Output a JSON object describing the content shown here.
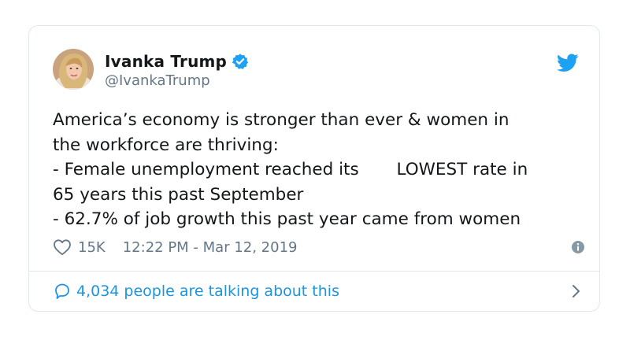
{
  "tweet": {
    "display_name": "Ivanka Trump",
    "handle": "@IvankaTrump",
    "text": "America’s economy is stronger than ever & women in\nthe workforce are thriving:\n- Female unemployment reached its       LOWEST rate in\n65 years this past September\n- 62.7% of job growth this past year came from women",
    "likes": "15K",
    "timestamp": "12:22 PM - Mar 12, 2019",
    "talking": "4,034 people are talking about this"
  },
  "icons": {
    "verified": "verified-badge-icon",
    "twitter": "twitter-bird-icon",
    "like": "heart-icon",
    "info": "info-icon",
    "reply": "speech-bubble-icon",
    "chevron": "chevron-right-icon"
  },
  "colors": {
    "brand_blue": "#1da1f2",
    "link_blue": "#1b95e0",
    "secondary_text": "#657786",
    "border": "#e1e8ed"
  }
}
